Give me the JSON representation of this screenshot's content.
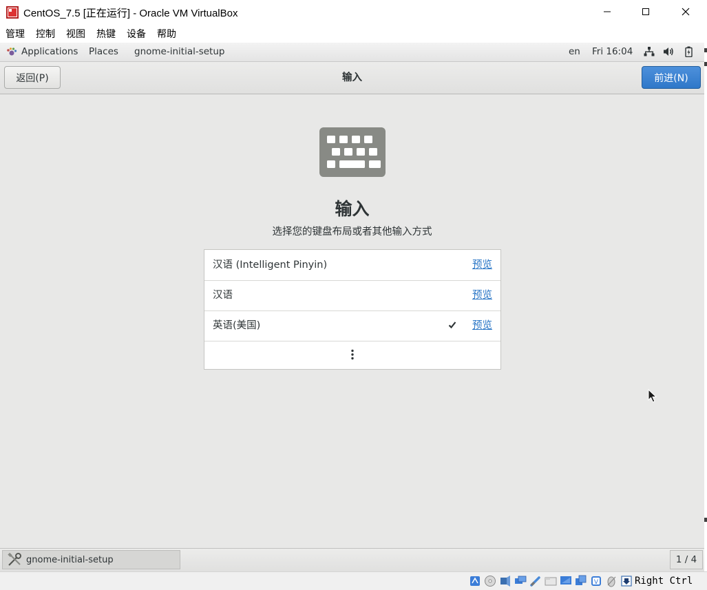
{
  "vbox": {
    "title": "CentOS_7.5 [正在运行] - Oracle VM VirtualBox",
    "menu": [
      "管理",
      "控制",
      "视图",
      "热键",
      "设备",
      "帮助"
    ],
    "host_key": "Right Ctrl"
  },
  "gnome_topbar": {
    "applications": "Applications",
    "places": "Places",
    "active_window": "gnome-initial-setup",
    "language": "en",
    "clock": "Fri 16:04"
  },
  "setup": {
    "back_label": "返回(P)",
    "header_title": "输入",
    "next_label": "前进(N)",
    "heading": "输入",
    "subtitle": "选择您的键盘布局或者其他输入方式",
    "inputs": [
      {
        "label": "汉语 (Intelligent Pinyin)",
        "preview": "预览",
        "selected": false
      },
      {
        "label": "汉语",
        "preview": "预览",
        "selected": false
      },
      {
        "label": "英语(美国)",
        "preview": "预览",
        "selected": true
      }
    ]
  },
  "bottombar": {
    "task": "gnome-initial-setup",
    "workspace": "1 / 4"
  },
  "colors": {
    "accent": "#2f78c9",
    "link": "#2a76c6",
    "background": "#e8e8e7"
  }
}
